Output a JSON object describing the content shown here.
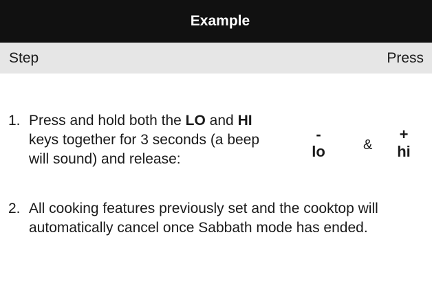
{
  "header": {
    "title": "Example"
  },
  "columns": {
    "step": "Step",
    "press": "Press"
  },
  "steps": [
    {
      "number": "1.",
      "parts": [
        {
          "text": "Press and hold both the ",
          "bold": false
        },
        {
          "text": "LO",
          "bold": true
        },
        {
          "text": " and ",
          "bold": false
        },
        {
          "text": "HI",
          "bold": true
        },
        {
          "text": " keys together for 3 seconds (a beep will sound) and release:",
          "bold": false
        }
      ]
    },
    {
      "number": "2.",
      "text": "All cooking features previously set and the cooktop will automatically cancel once Sabbath mode has ended."
    }
  ],
  "keys": {
    "lo": {
      "symbol": "-",
      "label": "lo"
    },
    "separator": "&",
    "hi": {
      "symbol": "+",
      "label": "hi"
    }
  }
}
